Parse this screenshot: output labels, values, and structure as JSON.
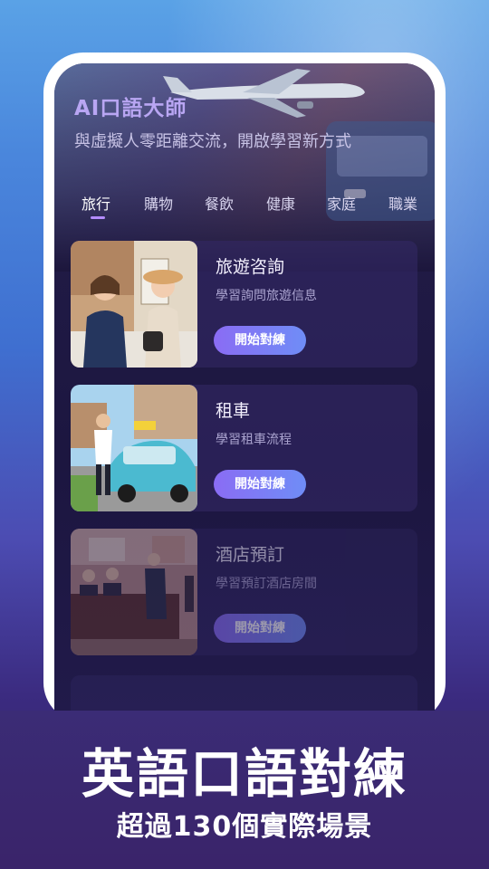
{
  "app": {
    "title": "AI口語大師",
    "subtitle": "與虛擬人零距離交流，開啟學習新方式"
  },
  "tabs": [
    {
      "label": "旅行",
      "active": true
    },
    {
      "label": "購物",
      "active": false
    },
    {
      "label": "餐飲",
      "active": false
    },
    {
      "label": "健康",
      "active": false
    },
    {
      "label": "家庭",
      "active": false
    },
    {
      "label": "職業",
      "active": false
    }
  ],
  "scenarios": [
    {
      "title": "旅遊咨詢",
      "desc": "學習詢問旅遊信息",
      "button": "開始對練"
    },
    {
      "title": "租車",
      "desc": "學習租車流程",
      "button": "開始對練"
    },
    {
      "title": "酒店預訂",
      "desc": "學習預訂酒店房間",
      "button": "開始對練"
    }
  ],
  "promo": {
    "headline": "英語口語對練",
    "subheadline": "超過130個實際場景"
  },
  "colors": {
    "accent": "#b48cff",
    "button_start": "#8a6cf4",
    "button_end": "#6f8df6"
  }
}
